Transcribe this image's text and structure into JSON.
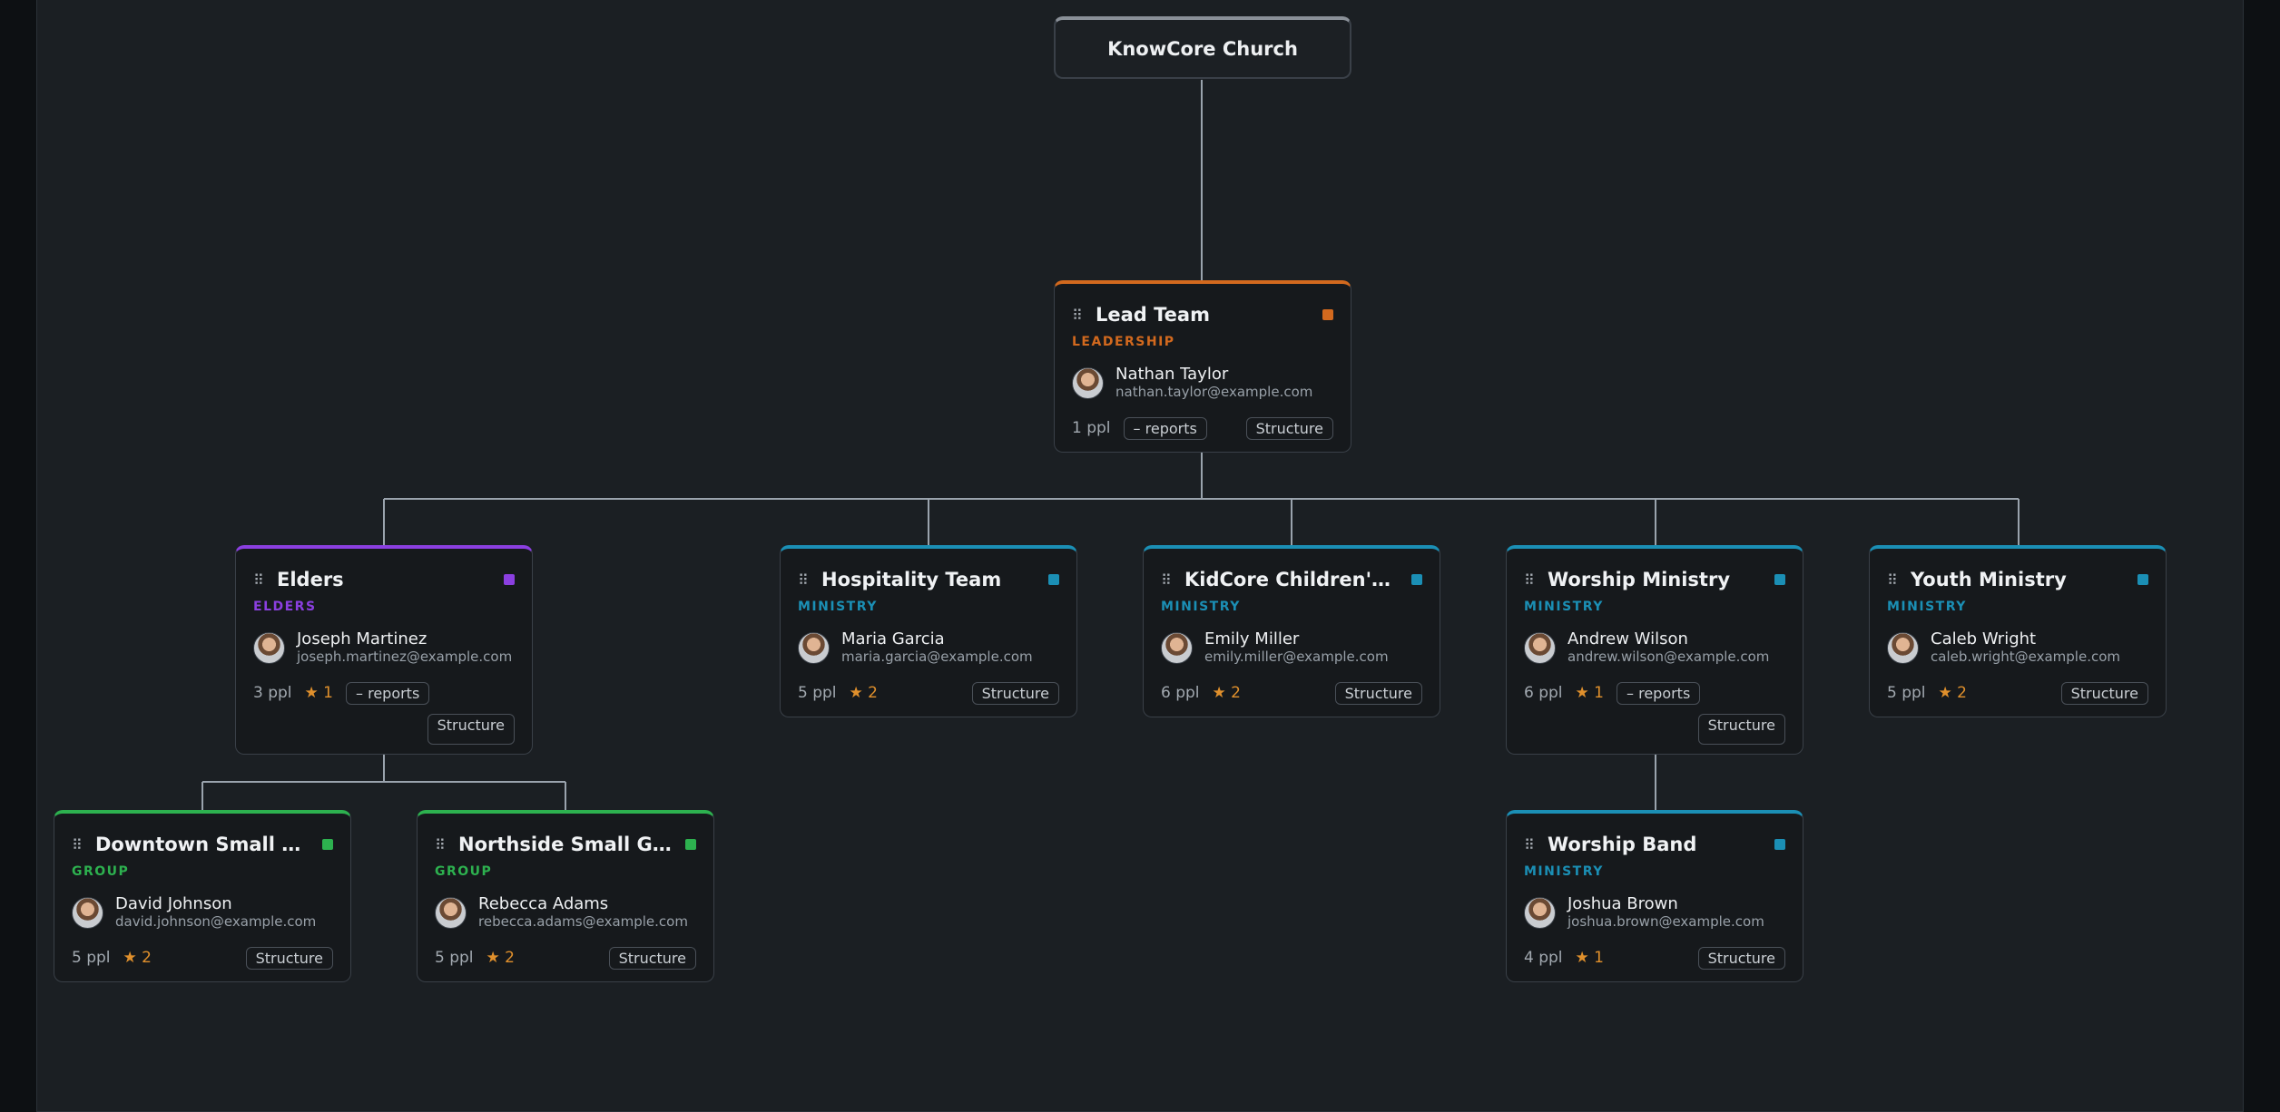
{
  "root": {
    "name": "KnowCore Church"
  },
  "teams": {
    "lead": {
      "name": "Lead Team",
      "category": "LEADERSHIP",
      "accent": "#d2691e",
      "person": "Nathan Taylor",
      "email": "nathan.taylor@example.com",
      "count": "1 ppl",
      "stars": "",
      "reports": "– reports",
      "structure": "Structure"
    },
    "elders": {
      "name": "Elders",
      "category": "ELDERS",
      "accent": "#8b3fe0",
      "person": "Joseph Martinez",
      "email": "joseph.martinez@example.com",
      "count": "3 ppl",
      "stars": "★ 1",
      "reports": "– reports",
      "structure": "Structure"
    },
    "hospitality": {
      "name": "Hospitality Team",
      "category": "MINISTRY",
      "accent": "#1b8fb5",
      "person": "Maria Garcia",
      "email": "maria.garcia@example.com",
      "count": "5 ppl",
      "stars": "★ 2",
      "structure": "Structure"
    },
    "kidcore": {
      "name": "KidCore Children's Ministry",
      "category": "MINISTRY",
      "accent": "#1b8fb5",
      "person": "Emily Miller",
      "email": "emily.miller@example.com",
      "count": "6 ppl",
      "stars": "★ 2",
      "structure": "Structure"
    },
    "worship": {
      "name": "Worship Ministry",
      "category": "MINISTRY",
      "accent": "#1b8fb5",
      "person": "Andrew Wilson",
      "email": "andrew.wilson@example.com",
      "count": "6 ppl",
      "stars": "★ 1",
      "reports": "– reports",
      "structure": "Structure"
    },
    "youth": {
      "name": "Youth Ministry",
      "category": "MINISTRY",
      "accent": "#1b8fb5",
      "person": "Caleb Wright",
      "email": "caleb.wright@example.com",
      "count": "5 ppl",
      "stars": "★ 2",
      "structure": "Structure"
    },
    "downtown": {
      "name": "Downtown Small Group",
      "category": "GROUP",
      "accent": "#2db14f",
      "person": "David Johnson",
      "email": "david.johnson@example.com",
      "count": "5 ppl",
      "stars": "★ 2",
      "structure": "Structure"
    },
    "northside": {
      "name": "Northside Small Group",
      "category": "GROUP",
      "accent": "#2db14f",
      "person": "Rebecca Adams",
      "email": "rebecca.adams@example.com",
      "count": "5 ppl",
      "stars": "★ 2",
      "structure": "Structure"
    },
    "band": {
      "name": "Worship Band",
      "category": "MINISTRY",
      "accent": "#1b8fb5",
      "person": "Joshua Brown",
      "email": "joshua.brown@example.com",
      "count": "4 ppl",
      "stars": "★ 1",
      "structure": "Structure"
    }
  }
}
